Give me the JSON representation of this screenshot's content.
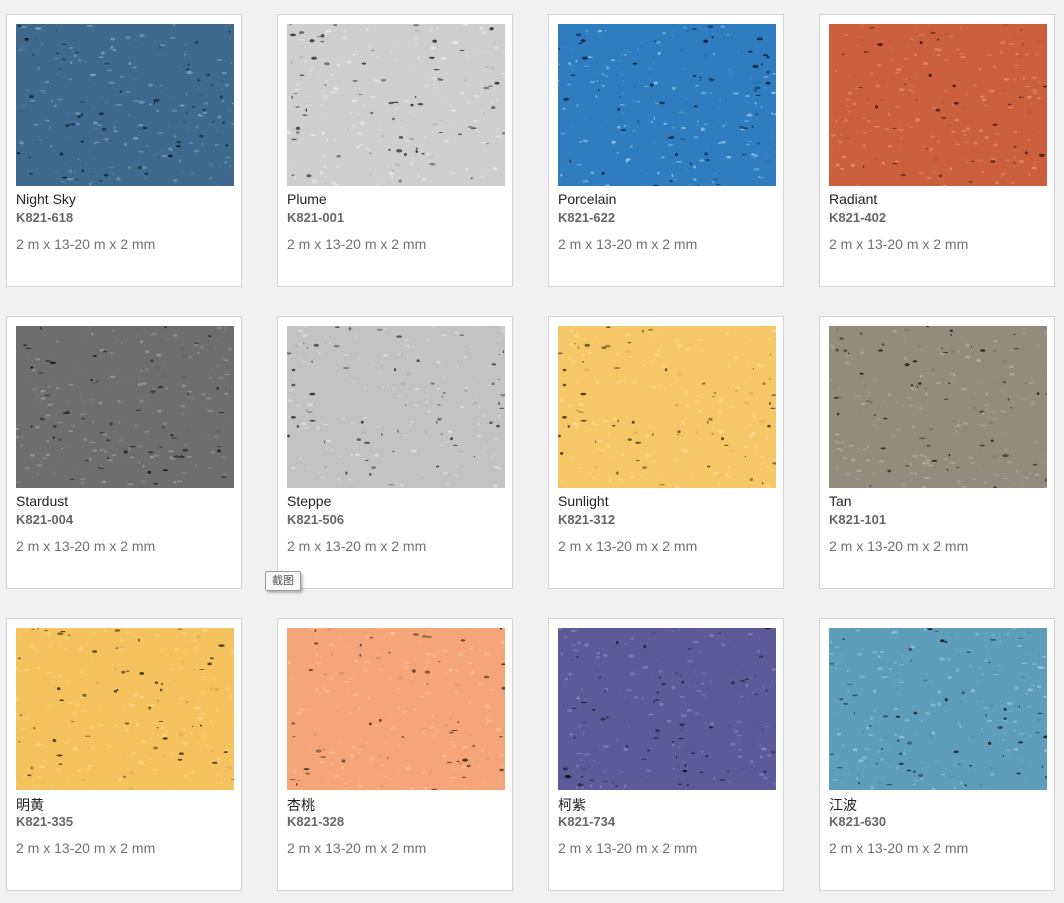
{
  "products": [
    {
      "name": "Night Sky",
      "code": "K821-618",
      "size": "2 m x 13-20 m x 2 mm",
      "color": "#3f6a8e",
      "speck": "#8fb0cc"
    },
    {
      "name": "Plume",
      "code": "K821-001",
      "size": "2 m x 13-20 m x 2 mm",
      "color": "#cfcfcf",
      "speck": "#f2f2f2"
    },
    {
      "name": "Porcelain",
      "code": "K821-622",
      "size": "2 m x 13-20 m x 2 mm",
      "color": "#2f7cc0",
      "speck": "#a8d2f2"
    },
    {
      "name": "Radiant",
      "code": "K821-402",
      "size": "2 m x 13-20 m x 2 mm",
      "color": "#cc5f3e",
      "speck": "#ee9a78"
    },
    {
      "name": "Stardust",
      "code": "K821-004",
      "size": "2 m x 13-20 m x 2 mm",
      "color": "#6e6e6e",
      "speck": "#a6a6a6"
    },
    {
      "name": "Steppe",
      "code": "K821-506",
      "size": "2 m x 13-20 m x 2 mm",
      "color": "#c3c3c3",
      "speck": "#e6e6e6"
    },
    {
      "name": "Sunlight",
      "code": "K821-312",
      "size": "2 m x 13-20 m x 2 mm",
      "color": "#f6c766",
      "speck": "#fde2a6"
    },
    {
      "name": "Tan",
      "code": "K821-101",
      "size": "2 m x 13-20 m x 2 mm",
      "color": "#938b7c",
      "speck": "#bcb4a4"
    },
    {
      "name": "明黄",
      "code": "K821-335",
      "size": "2 m x 13-20 m x 2 mm",
      "color": "#f5c35e",
      "speck": "#fbdc94"
    },
    {
      "name": "杏桃",
      "code": "K821-328",
      "size": "2 m x 13-20 m x 2 mm",
      "color": "#f5a679",
      "speck": "#fcc9a6"
    },
    {
      "name": "柯紫",
      "code": "K821-734",
      "size": "2 m x 13-20 m x 2 mm",
      "color": "#5e5a9a",
      "speck": "#8f8cc4"
    },
    {
      "name": "江波",
      "code": "K821-630",
      "size": "2 m x 13-20 m x 2 mm",
      "color": "#5f9ebb",
      "speck": "#a5d0e2"
    }
  ],
  "tooltip": {
    "label": "截图"
  }
}
